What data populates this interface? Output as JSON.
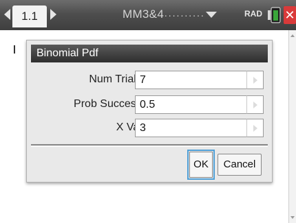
{
  "topbar": {
    "page_tab": "1.1",
    "doc_title": "MM3&4",
    "doc_title_dots": "...........",
    "angle_mode": "RAD",
    "icons": {
      "nav_left": "chevron-left-icon",
      "nav_right": "chevron-right-icon",
      "doc_menu": "chevron-down-icon",
      "battery": "battery-icon",
      "close": "close-icon"
    },
    "colors": {
      "bar": "#4e4e4e",
      "close": "#d93a3a",
      "battery": "#3aa63a"
    }
  },
  "dialog": {
    "title": "Binomial Pdf",
    "fields": [
      {
        "label": "Num Trials, n:",
        "value": "7"
      },
      {
        "label": "Prob Success, p:",
        "value": "0.5"
      },
      {
        "label": "X Value:",
        "value": "3"
      }
    ],
    "ok_label": "OK",
    "cancel_label": "Cancel",
    "colors": {
      "titlebar": "#2e2e2e",
      "focus": "#4f9fd6"
    }
  }
}
